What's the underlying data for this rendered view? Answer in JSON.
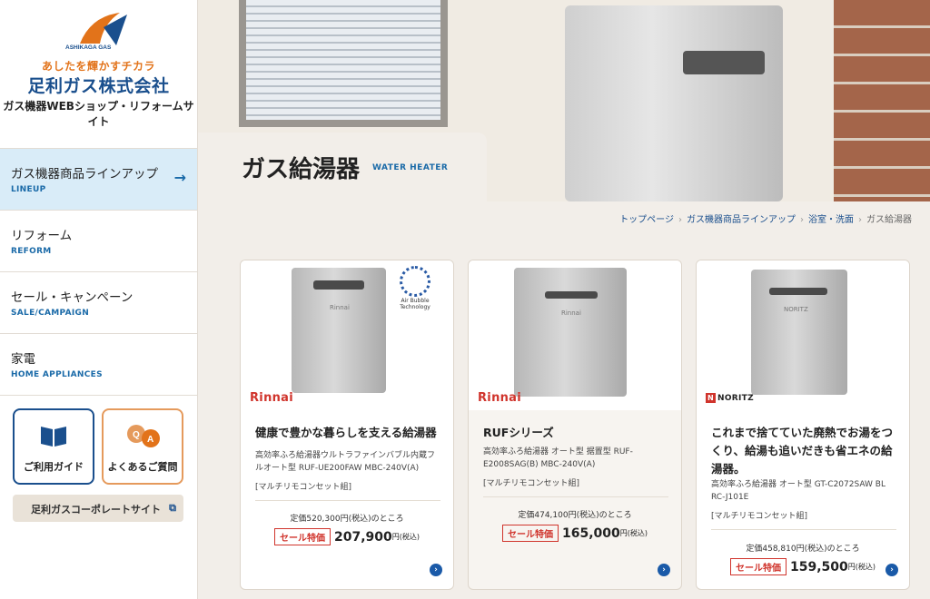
{
  "sidebar": {
    "logo_text": "ASHIKAGA GAS",
    "tagline": "あしたを輝かすチカラ",
    "company": "足利ガス株式会社",
    "shop_title": "ガス機器WEBショップ・リフォームサイト",
    "nav": [
      {
        "label": "ガス機器商品ラインアップ",
        "sub": "LINEUP",
        "active": true
      },
      {
        "label": "リフォーム",
        "sub": "REFORM"
      },
      {
        "label": "セール・キャンペーン",
        "sub": "SALE/CAMPAIGN"
      },
      {
        "label": "家電",
        "sub": "HOME APPLIANCES"
      }
    ],
    "guide_label": "ご利用ガイド",
    "faq_label": "よくあるご質問",
    "corporate_link": "足利ガスコーポレートサイト"
  },
  "hero": {
    "title": "ガス給湯器",
    "title_en": "WATER HEATER"
  },
  "breadcrumb": [
    "トップページ",
    "ガス機器商品ラインアップ",
    "浴室・洗面",
    "ガス給湯器"
  ],
  "products": [
    {
      "brand": "Rinnai",
      "badge_text": "Air Bubble Technology",
      "heater_label": "Rinnai",
      "name": "健康で豊かな暮らしを支える給湯器",
      "model": "高効率ふろ給湯器ウルトラファインバブル内蔵フルオート型 RUF-UE200FAW MBC-240V(A)",
      "set": "[マルチリモコンセット組]",
      "list_price": "定価520,300円(税込)のところ",
      "sale_label": "セール特価",
      "sale_price": "207,900",
      "unit": "円(税込)"
    },
    {
      "brand": "Rinnai",
      "heater_label": "Rinnai",
      "name": "RUFシリーズ",
      "model": "高効率ふろ給湯器 オート型 据置型 RUF-E2008SAG(B) MBC-240V(A)",
      "set": "[マルチリモコンセット組]",
      "list_price": "定価474,100円(税込)のところ",
      "sale_label": "セール特価",
      "sale_price": "165,000",
      "unit": "円(税込)"
    },
    {
      "brand_prefix": "N",
      "brand": "NORITZ",
      "heater_label": "NORITZ",
      "name": "これまで捨てていた廃熱でお湯をつくり、給湯も追いだきも省エネの給湯器。",
      "model": "高効率ふろ給湯器 オート型 GT-C2072SAW BL RC-J101E",
      "set": "[マルチリモコンセット組]",
      "list_price": "定価458,810円(税込)のところ",
      "sale_label": "セール特価",
      "sale_price": "159,500",
      "unit": "円(税込)"
    }
  ],
  "colors": {
    "brand_blue": "#1a4f8d",
    "accent_orange": "#e2731a",
    "sale_red": "#d0342c",
    "page_bg": "#f2eee9"
  },
  "icons": {
    "nav_arrow": "arrow-right-icon",
    "guide": "book-icon",
    "faq": "qa-bubble-icon",
    "external": "external-link-icon",
    "card_arrow": "chevron-right-circle-icon"
  }
}
